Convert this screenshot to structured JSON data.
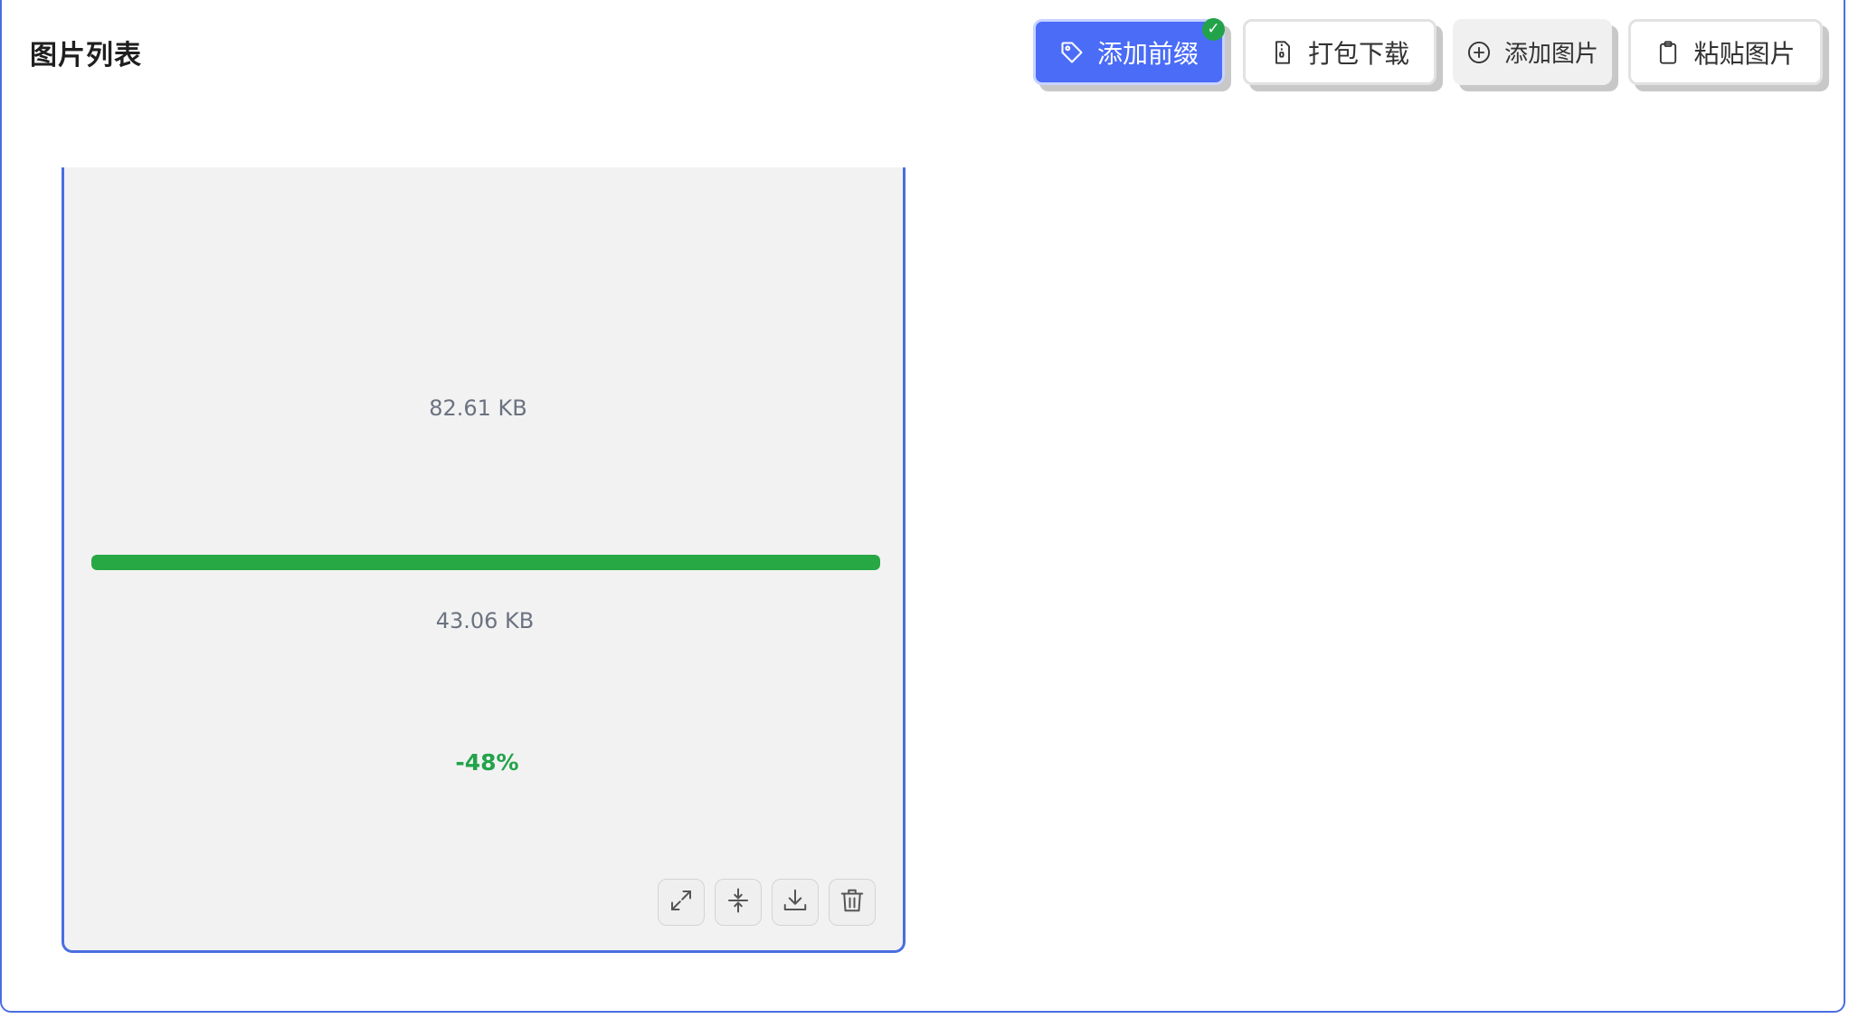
{
  "header": {
    "title": "图片列表"
  },
  "toolbar": {
    "add_prefix_label": "添加前缀",
    "add_prefix_checked": true,
    "zip_download_label": "打包下载",
    "add_image_label": "添加图片",
    "paste_image_label": "粘贴图片",
    "icons": [
      "tag-icon",
      "zip-file-icon",
      "plus-circle-icon",
      "clipboard-icon"
    ]
  },
  "image_card": {
    "original_size": "82.61 KB",
    "compressed_size": "43.06 KB",
    "reduction": "-48%",
    "progress_percent": 100,
    "actions": [
      "expand-icon",
      "compress-icon",
      "download-icon",
      "trash-icon"
    ]
  },
  "colors": {
    "accent": "#4a6cf7",
    "border": "#4a6ee0",
    "success": "#22a34a"
  }
}
